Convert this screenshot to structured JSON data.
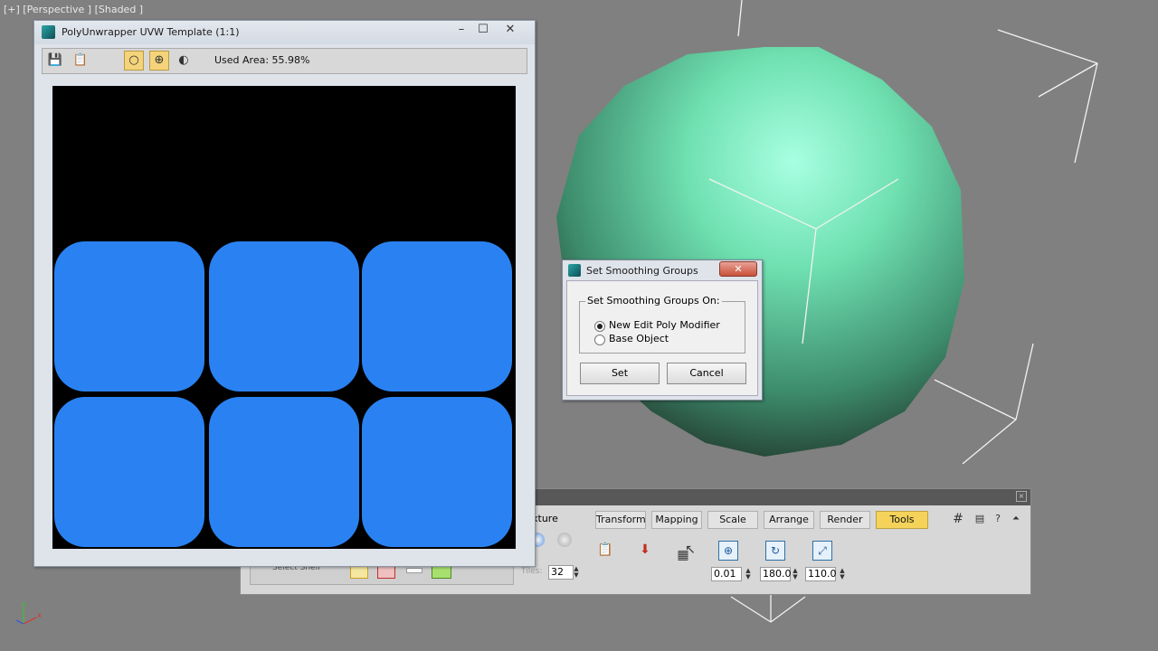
{
  "viewport": {
    "label": "[+] [Perspective ] [Shaded ]"
  },
  "template_window": {
    "title": "PolyUnwrapper UVW Template (1:1)",
    "controls": {
      "minimize": "–",
      "maximize": "☐",
      "close": "✕"
    },
    "used_area": "Used Area: 55.98%"
  },
  "dialog": {
    "title": "Set Smoothing Groups",
    "close": "✕",
    "group_label": "Set Smoothing Groups On:",
    "options": [
      {
        "label": "New Edit Poly Modifier",
        "selected": true
      },
      {
        "label": "Base Object",
        "selected": false
      }
    ],
    "set_button": "Set",
    "cancel_button": "Cancel"
  },
  "panel": {
    "partial_label": "xture",
    "tiles_label": "Tiles:",
    "tiles_value": "32",
    "select_label": "Select Shell",
    "tabs": [
      {
        "label": "Transform",
        "active": false
      },
      {
        "label": "Mapping",
        "active": false
      },
      {
        "label": "Scale",
        "active": false
      },
      {
        "label": "Arrange",
        "active": false
      },
      {
        "label": "Render",
        "active": false
      },
      {
        "label": "Tools",
        "active": true
      }
    ],
    "spinners": {
      "first": "0.01",
      "second": "180.0",
      "third": "110.0"
    }
  },
  "colors": {
    "background": "#808080",
    "uv_island": "#2a82f2",
    "sphere": "#6fe0b0",
    "active_tab": "#f5d35a"
  }
}
